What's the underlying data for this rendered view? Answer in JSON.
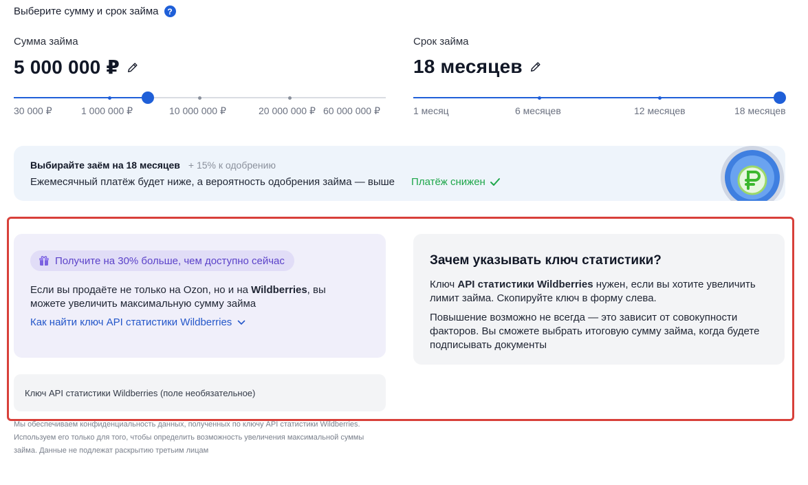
{
  "header": {
    "title": "Выберите сумму и срок займа",
    "help_icon": "question-circle-icon"
  },
  "amount": {
    "label": "Сумма займа",
    "value": "5 000 000 ₽",
    "slider_fraction": 0.36,
    "ticks": [
      "30 000 ₽",
      "1 000 000 ₽",
      "10 000 000 ₽",
      "20 000 000 ₽",
      "60 000 000 ₽"
    ]
  },
  "term": {
    "label": "Срок займа",
    "value": "18 месяцев",
    "slider_fraction": 1.0,
    "ticks": [
      "1 месяц",
      "6 месяцев",
      "12 месяцев",
      "18 месяцев"
    ]
  },
  "promo": {
    "title": "Выбирайте заём на 18 месяцев",
    "bonus": "+ 15% к одобрению",
    "text": "Ежемесячный платёж будет ниже, а вероятность одобрения займа — выше",
    "status": "Платёж снижен",
    "status_icon": "check-icon",
    "badge_icon": "ruble-clock-icon"
  },
  "wb_card": {
    "chip": "Получите на 30% больше, чем доступно сейчас",
    "chip_icon": "gift-icon",
    "text_before": "Если вы продаёте не только на Ozon, но и на ",
    "text_bold": "Wildberries",
    "text_after": ", вы можете увеличить максимальную сумму займа",
    "link": "Как найти ключ API статистики Wildberries"
  },
  "api_input": {
    "placeholder": "Ключ API статистики Wildberries (поле необязательное)",
    "value": ""
  },
  "info_card": {
    "title": "Зачем указывать ключ статистики?",
    "p1_before": "Ключ ",
    "p1_bold": "API статистики Wildberries",
    "p1_after": " нужен, если вы хотите увеличить лимит займа. Скопируйте ключ в форму слева.",
    "p2": "Повышение возможно не всегда — это зависит от совокупности факторов. Вы сможете выбрать итоговую сумму займа, когда будете подписывать документы"
  },
  "disclaimer": "Мы обеспечиваем конфиденциальность данных, полученных по ключу API статистики Wildberries. Используем его только для того, чтобы определить возможность увеличения максимальной суммы займа. Данные не подлежат раскрытию третьим лицам",
  "colors": {
    "accent": "#1f5fd8",
    "success": "#1ea64a",
    "highlight": "#d8403a",
    "chip_text": "#5b42c9"
  }
}
